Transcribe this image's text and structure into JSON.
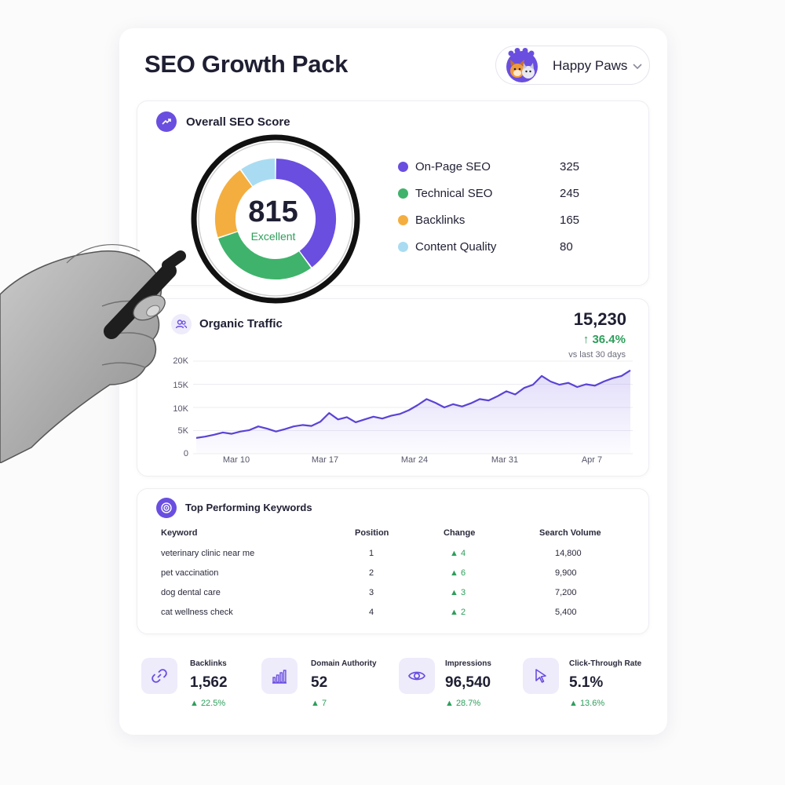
{
  "header": {
    "title": "SEO Growth Pack"
  },
  "account": {
    "name": "Happy Paws"
  },
  "score": {
    "heading": "Overall SEO Score",
    "value": "815",
    "rating": "Excellent",
    "breakdown": [
      {
        "label": "On-Page SEO",
        "value": "325",
        "color": "#6a4ee0"
      },
      {
        "label": "Technical SEO",
        "value": "245",
        "color": "#3fb36b"
      },
      {
        "label": "Backlinks",
        "value": "165",
        "color": "#f4ae3f"
      },
      {
        "label": "Content Quality",
        "value": "80",
        "color": "#a9dcf2"
      }
    ]
  },
  "traffic": {
    "heading": "Organic Traffic",
    "total": "15,230",
    "change": "36.4%",
    "period": "vs last 30 days",
    "y_ticks": [
      "20K",
      "15K",
      "10K",
      "5K",
      "0"
    ],
    "x_ticks": [
      "Mar 10",
      "Mar 17",
      "Mar 24",
      "Mar 31",
      "Apr 7"
    ],
    "line_color": "#5b43d6"
  },
  "chart_data": {
    "type": "area",
    "x": [
      "Mar 6",
      "Mar 7",
      "Mar 8",
      "Mar 9",
      "Mar 10",
      "Mar 11",
      "Mar 12",
      "Mar 13",
      "Mar 14",
      "Mar 15",
      "Mar 16",
      "Mar 17",
      "Mar 18",
      "Mar 19",
      "Mar 20",
      "Mar 21",
      "Mar 22",
      "Mar 23",
      "Mar 24",
      "Mar 25",
      "Mar 26",
      "Mar 27",
      "Mar 28",
      "Mar 29",
      "Mar 30",
      "Mar 31",
      "Apr 1",
      "Apr 2",
      "Apr 3",
      "Apr 4",
      "Apr 5",
      "Apr 6",
      "Apr 7",
      "Apr 8",
      "Apr 9"
    ],
    "series": [
      {
        "values": [
          3400,
          3700,
          4100,
          4600,
          4300,
          4800,
          5100,
          5900,
          5400,
          4800,
          5300,
          5900,
          6200,
          6000,
          6900,
          8800,
          7400,
          7900,
          6800,
          7400,
          8000,
          7600,
          8200,
          8600,
          9400,
          10500,
          11800,
          11000,
          10000,
          10700,
          10200,
          10900,
          11800,
          11500,
          12400,
          13500,
          12800,
          14200,
          14900,
          16800,
          15600,
          14900,
          15300,
          14400,
          15000,
          14700,
          15600,
          16300,
          16800,
          18000
        ]
      }
    ],
    "xlabel": "",
    "ylabel": "",
    "ylim": [
      0,
      20000
    ]
  },
  "keywords": {
    "heading": "Top Performing Keywords",
    "columns": [
      "Keyword",
      "Position",
      "Change",
      "Search Volume"
    ],
    "rows": [
      {
        "keyword": "veterinary clinic near me",
        "position": "1",
        "change": "▲ 4",
        "volume": "14,800"
      },
      {
        "keyword": "pet vaccination",
        "position": "2",
        "change": "▲ 6",
        "volume": "9,900"
      },
      {
        "keyword": "dog dental care",
        "position": "3",
        "change": "▲ 3",
        "volume": "7,200"
      },
      {
        "keyword": "cat wellness check",
        "position": "4",
        "change": "▲ 2",
        "volume": "5,400"
      }
    ]
  },
  "stats": [
    {
      "label": "Backlinks",
      "value": "1,562",
      "change": "▲ 22.5%",
      "icon": "link-icon"
    },
    {
      "label": "Domain Authority",
      "value": "52",
      "change": "▲ 7",
      "icon": "bar-chart-icon"
    },
    {
      "label": "Impressions",
      "value": "96,540",
      "change": "▲ 28.7%",
      "icon": "eye-icon"
    },
    {
      "label": "Click-Through Rate",
      "value": "5.1%",
      "change": "▲ 13.6%",
      "icon": "cursor-icon"
    }
  ],
  "colors": {
    "accent": "#6a4ee0",
    "positive": "#2e9e5b"
  }
}
